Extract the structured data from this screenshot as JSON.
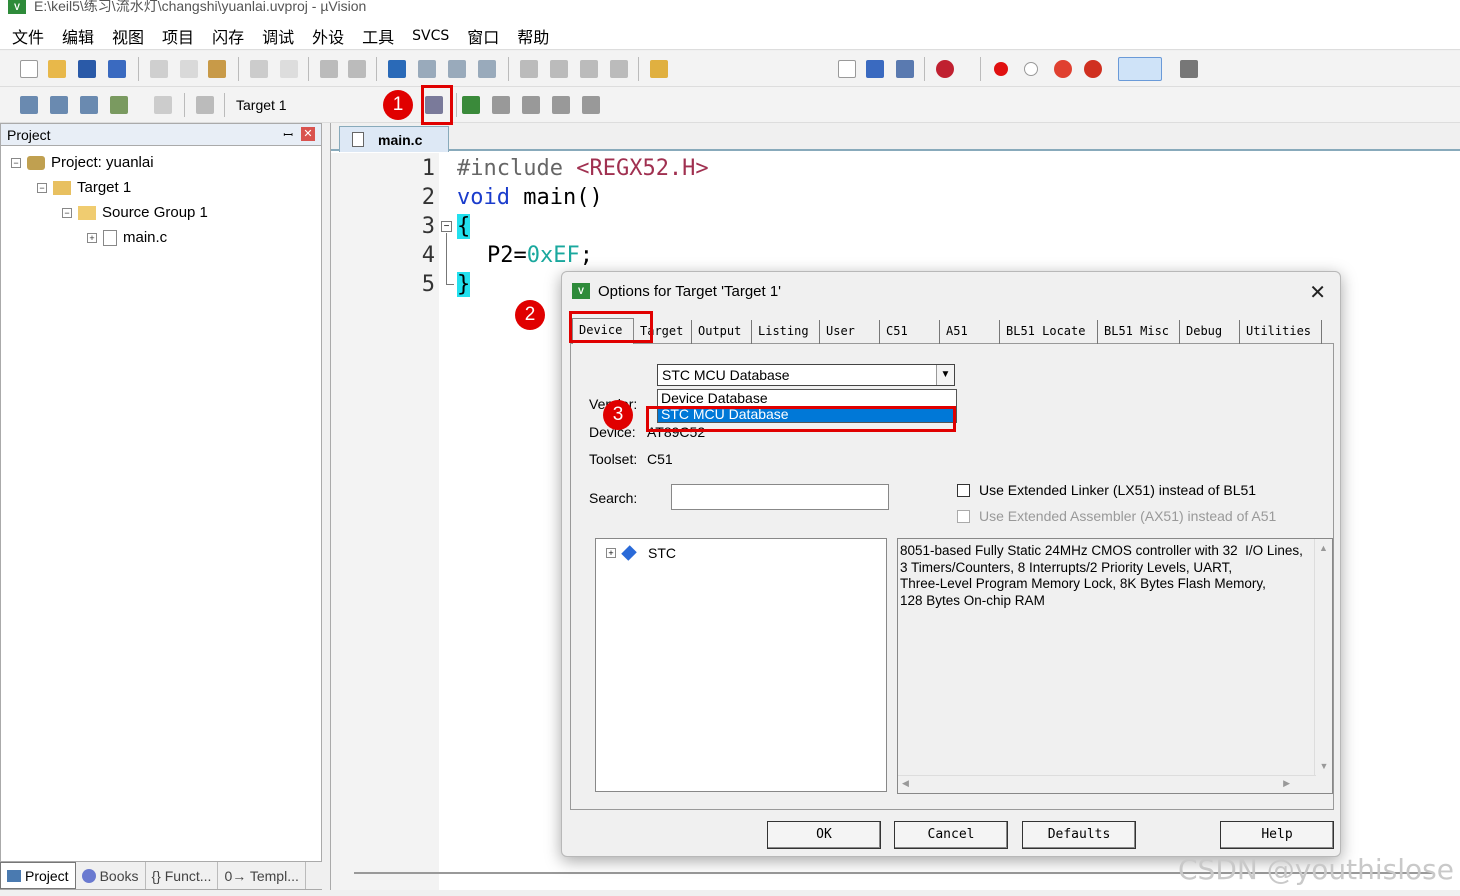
{
  "window": {
    "title": "E:\\keil5\\练习\\流水灯\\changshi\\yuanlai.uvproj - µVision",
    "logo": "V"
  },
  "menu": [
    "文件",
    "编辑",
    "视图",
    "项目",
    "闪存",
    "调试",
    "外设",
    "工具",
    "SVCS",
    "窗口",
    "帮助"
  ],
  "toolbar2": {
    "target_label": "Target 1"
  },
  "project_panel": {
    "title": "Project",
    "pin": "ꟷ",
    "close": "✕",
    "tree": [
      {
        "label": "Project: yuanlai"
      },
      {
        "label": "Target 1"
      },
      {
        "label": "Source Group 1"
      },
      {
        "label": "main.c"
      }
    ],
    "bottom_tabs": [
      "Project",
      "Books",
      "{} Funct...",
      "0→ Templ..."
    ]
  },
  "editor": {
    "tab": "main.c",
    "line_numbers": [
      "1",
      "2",
      "3",
      "4",
      "5"
    ],
    "code": {
      "l1_a": "#include ",
      "l1_b": "<REGX52.H>",
      "l2_a": "void ",
      "l2_b": "main()",
      "l3": "{",
      "l4_a": "P2=",
      "l4_b": "0xEF",
      "l4_c": ";",
      "l5": "}"
    }
  },
  "dialog": {
    "title": "Options for Target 'Target 1'",
    "close": "✕",
    "tabs": [
      "Device",
      "Target",
      "Output",
      "Listing",
      "User",
      "C51",
      "A51",
      "BL51 Locate",
      "BL51 Misc",
      "Debug",
      "Utilities"
    ],
    "database_selected": "STC MCU Database",
    "dropdown_options": [
      "Device Database",
      "STC MCU Database"
    ],
    "vendor_label": "Vendor:",
    "device_label": "Device:",
    "device_value": "AT89C52",
    "toolset_label": "Toolset:",
    "toolset_value": "C51",
    "search_label": "Search:",
    "search_value": "",
    "chk_linker": "Use Extended Linker (LX51) instead of BL51",
    "chk_assembler": "Use Extended Assembler (AX51) instead of A51",
    "tree_item": "STC",
    "description": "8051-based Fully Static 24MHz CMOS controller with 32  I/O Lines,\n3 Timers/Counters, 8 Interrupts/2 Priority Levels, UART,\nThree-Level Program Memory Lock, 8K Bytes Flash Memory,\n128 Bytes On-chip RAM",
    "buttons": {
      "ok": "OK",
      "cancel": "Cancel",
      "defaults": "Defaults",
      "help": "Help"
    }
  },
  "annotations": [
    "1",
    "2",
    "3"
  ],
  "watermark": "CSDN @youthislose",
  "colors": {
    "annotation_red": "#e00000",
    "selection_blue": "#0078d7",
    "brace_highlight": "#22e0ee"
  }
}
